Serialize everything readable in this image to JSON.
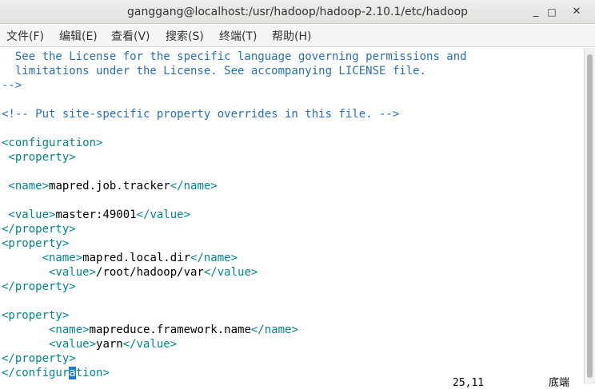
{
  "window": {
    "title": "ganggang@localhost:/usr/hadoop/hadoop-2.10.1/etc/hadoop",
    "minimize_glyph": "_",
    "maximize_glyph": "□",
    "close_glyph": "✕"
  },
  "menu": [
    "文件(F)",
    "编辑(E)",
    "查看(V)",
    "搜索(S)",
    "终端(T)",
    "帮助(H)"
  ],
  "editor": {
    "lines": [
      [
        {
          "t": "  See the License for the specific language governing permissions and",
          "c": "cm"
        }
      ],
      [
        {
          "t": "  limitations under the License. See accompanying LICENSE file.",
          "c": "cm"
        }
      ],
      [
        {
          "t": "-->",
          "c": "cm"
        }
      ],
      [
        {
          "t": "",
          "c": "tx"
        }
      ],
      [
        {
          "t": "<!-- Put site-specific property overrides in this file. -->",
          "c": "cm"
        }
      ],
      [
        {
          "t": "",
          "c": "tx"
        }
      ],
      [
        {
          "t": "<configuration>",
          "c": "tg"
        }
      ],
      [
        {
          "t": " <property>",
          "c": "tg"
        }
      ],
      [
        {
          "t": "",
          "c": "tx"
        }
      ],
      [
        {
          "t": " <name>",
          "c": "tg"
        },
        {
          "t": "mapred.job.tracker",
          "c": "tx"
        },
        {
          "t": "</name>",
          "c": "tg"
        }
      ],
      [
        {
          "t": "",
          "c": "tx"
        }
      ],
      [
        {
          "t": " <value>",
          "c": "tg"
        },
        {
          "t": "master:49001",
          "c": "tx"
        },
        {
          "t": "</value>",
          "c": "tg"
        }
      ],
      [
        {
          "t": "</property>",
          "c": "tg"
        }
      ],
      [
        {
          "t": "<property>",
          "c": "tg"
        }
      ],
      [
        {
          "t": "      <name>",
          "c": "tg"
        },
        {
          "t": "mapred.local.dir",
          "c": "tx"
        },
        {
          "t": "</name>",
          "c": "tg"
        }
      ],
      [
        {
          "t": "       <value>",
          "c": "tg"
        },
        {
          "t": "/root/hadoop/var",
          "c": "tx"
        },
        {
          "t": "</value>",
          "c": "tg"
        }
      ],
      [
        {
          "t": "</property>",
          "c": "tg"
        }
      ],
      [
        {
          "t": "",
          "c": "tx"
        }
      ],
      [
        {
          "t": "<property>",
          "c": "tg"
        }
      ],
      [
        {
          "t": "       <name>",
          "c": "tg"
        },
        {
          "t": "mapreduce.framework.name",
          "c": "tx"
        },
        {
          "t": "</name>",
          "c": "tg"
        }
      ],
      [
        {
          "t": "       <value>",
          "c": "tg"
        },
        {
          "t": "yarn",
          "c": "tx"
        },
        {
          "t": "</value>",
          "c": "tg"
        }
      ],
      [
        {
          "t": "</property>",
          "c": "tg"
        }
      ],
      [
        {
          "t": "</configur",
          "c": "tg"
        },
        {
          "t": "a",
          "c": "cursor"
        },
        {
          "t": "tion>",
          "c": "tg"
        }
      ]
    ]
  },
  "status": {
    "position": "25,11",
    "scroll": "底端"
  },
  "colors": {
    "comment": "#2a6fb0",
    "tag": "#00868b",
    "text": "#000000",
    "cursor_bg": "#1c7ad3"
  }
}
